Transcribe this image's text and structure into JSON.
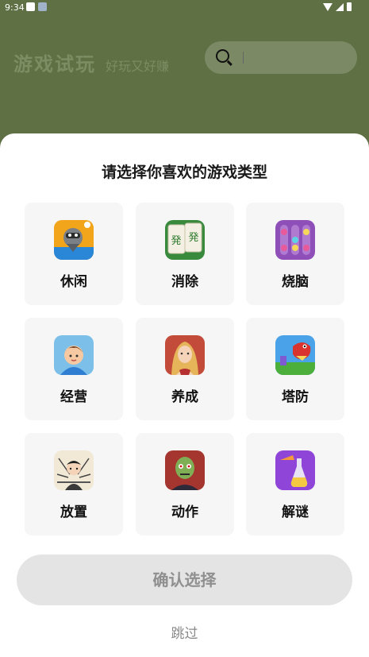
{
  "status_bar": {
    "time": "9:34"
  },
  "header": {
    "title": "游戏试玩",
    "subtitle": "好玩又好赚"
  },
  "search": {
    "placeholder": ""
  },
  "sheet": {
    "title": "请选择你喜欢的游戏类型",
    "categories": [
      {
        "label": "休闲",
        "icon": "robot-icon"
      },
      {
        "label": "消除",
        "icon": "mahjong-icon"
      },
      {
        "label": "烧脑",
        "icon": "ball-sort-icon"
      },
      {
        "label": "经营",
        "icon": "boy-avatar-icon"
      },
      {
        "label": "养成",
        "icon": "girl-character-icon"
      },
      {
        "label": "塔防",
        "icon": "dragon-icon"
      },
      {
        "label": "放置",
        "icon": "warrior-icon"
      },
      {
        "label": "动作",
        "icon": "zombie-icon"
      },
      {
        "label": "解谜",
        "icon": "potion-icon"
      }
    ],
    "confirm_label": "确认选择",
    "skip_label": "跳过"
  },
  "colors": {
    "backdrop": "#5e7044",
    "card": "#f6f6f6",
    "button": "#e4e4e4"
  }
}
